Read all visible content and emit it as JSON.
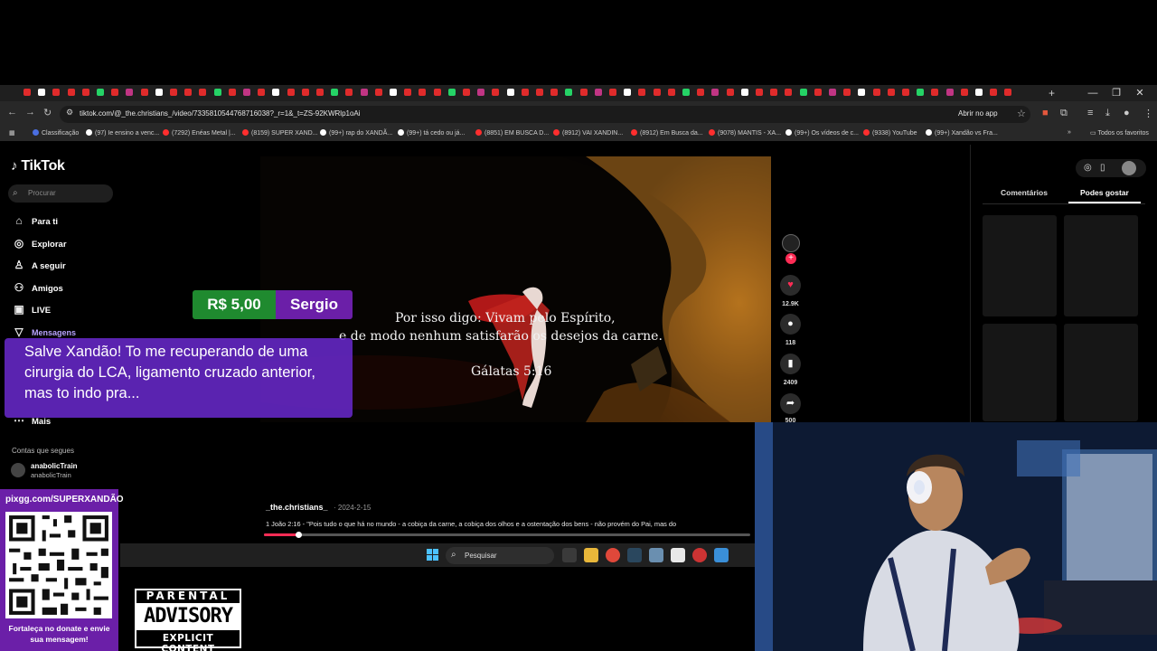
{
  "browser": {
    "url": "tiktok.com/@_the.christians_/video/7335810544768716038?_r=1&_t=ZS-92KWRlp1oAi",
    "open_in_app": "Abrir no app",
    "bookmarks": [
      {
        "label": "Classificação",
        "color": "#4a6ee0"
      },
      {
        "label": "(97) Ie ensino a venc...",
        "color": "#ffffff"
      },
      {
        "label": "(7292) Enéas Metal |...",
        "color": "#ff2e2e"
      },
      {
        "label": "(8159) SUPER XAND...",
        "color": "#ff2e2e"
      },
      {
        "label": "(99+) rap do XANDÃ...",
        "color": "#ffffff"
      },
      {
        "label": "(99+) tá cedo ou já...",
        "color": "#ffffff"
      },
      {
        "label": "(8851) EM BUSCA D...",
        "color": "#ff2e2e"
      },
      {
        "label": "(8912) VAI XANDIN...",
        "color": "#ff2e2e"
      },
      {
        "label": "(8912) Em Busca da...",
        "color": "#ff2e2e"
      },
      {
        "label": "(9078) MANTIS - XA...",
        "color": "#ff2e2e"
      },
      {
        "label": "(99+) Os vídeos de c...",
        "color": "#ffffff"
      },
      {
        "label": "(9338) YouTube",
        "color": "#ff2e2e"
      },
      {
        "label": "(99+) Xandão vs Fra...",
        "color": "#ffffff"
      }
    ],
    "all_favorites": "Todos os favoritos"
  },
  "tiktok": {
    "logo": "TikTok",
    "search_placeholder": "Procurar",
    "nav": [
      {
        "label": "Para ti",
        "icon": "home-icon",
        "glyph": "⌂"
      },
      {
        "label": "Explorar",
        "icon": "compass-icon",
        "glyph": "◎"
      },
      {
        "label": "A seguir",
        "icon": "following-icon",
        "glyph": "♙"
      },
      {
        "label": "Amigos",
        "icon": "friends-icon",
        "glyph": "⚇"
      },
      {
        "label": "LIVE",
        "icon": "live-icon",
        "glyph": "▣"
      },
      {
        "label": "Mensagens",
        "icon": "messages-icon",
        "glyph": "▽"
      },
      {
        "label": "Mais",
        "icon": "more-icon",
        "glyph": "⋯"
      }
    ],
    "following_title": "Contas que segues",
    "account": {
      "name": "anabolicTrain",
      "username": "anabolicTrain"
    },
    "video": {
      "caption_line1": "Por isso digo: Vivam pelo Espírito,",
      "caption_line2": "e de modo nenhum satisfarão os desejos da carne.",
      "caption_line3": "Gálatas 5:16",
      "author": "_the.christians_",
      "date": "· 2024-2-15",
      "description": "1 João 2:16 - \"Pois tudo o que há no mundo - a cobiça da carne, a cobiça dos olhos e a ostentação dos bens - não provém do Pai, mas do",
      "progress": 0.07
    },
    "actions": {
      "likes": "12.9K",
      "comments": "118",
      "saves": "2409",
      "shares": "500"
    },
    "right_tabs": {
      "comments": "Comentários",
      "you_may_like": "Podes gostar"
    }
  },
  "taskbar": {
    "search_label": "Pesquisar"
  },
  "overlay": {
    "donation_amount": "R$ 5,00",
    "donation_name": "Sergio",
    "donation_message": "Salve Xandão! To me recuperando de uma cirurgia do LCA, ligamento cruzado anterior, mas to indo pra...",
    "qr_url": "pixgg.com/SUPERXANDÃO",
    "qr_text": "Fortaleça no donate e envie sua mensagem!",
    "advisory_top": "PARENTAL",
    "advisory_mid": "ADVISORY",
    "advisory_bottom": "EXPLICIT CONTENT"
  }
}
